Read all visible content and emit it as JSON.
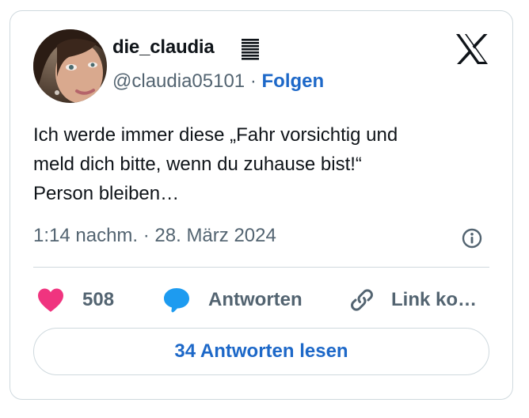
{
  "author": {
    "display_name": "die_claudia",
    "name_icon": "stacked-lines-icon",
    "handle": "@claudia05101",
    "separator": "·",
    "follow_label": "Folgen",
    "avatar_icon": "profile-photo"
  },
  "tweet": {
    "text": "Ich werde immer diese „Fahr vorsichtig und\nmeld dich bitte, wenn du zuhause bist!“\nPerson bleiben…",
    "timestamp": "1:14 nachm. · 28. März 2024"
  },
  "actions": {
    "like_count": "508",
    "reply_label": "Antworten",
    "copy_label": "Link ko…"
  },
  "read_replies_label": "34 Antworten lesen",
  "colors": {
    "accent": "#1d68c8",
    "heart": "#f0347f",
    "reply_bubble": "#1d9bf0",
    "muted": "#536471",
    "border": "#cfd9de"
  }
}
